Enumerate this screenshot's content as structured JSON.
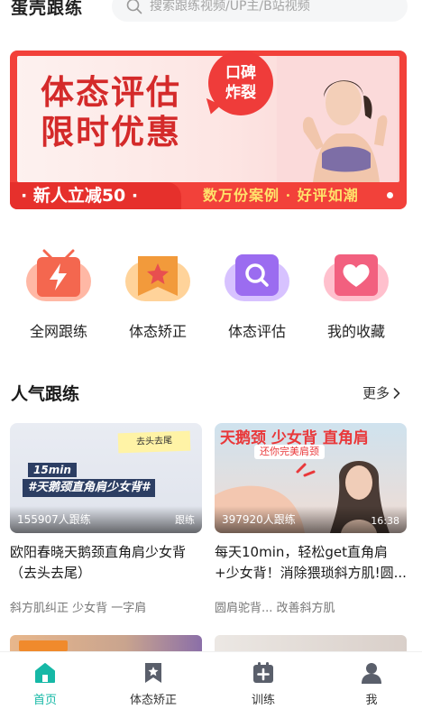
{
  "header": {
    "app_title": "蛋壳跟练",
    "search_placeholder": "搜索跟练视频/UP主/B站视频"
  },
  "banner": {
    "title_line1": "体态评估",
    "title_line2": "限时优惠",
    "bubble_line1": "口碑",
    "bubble_line2": "炸裂",
    "promo": "· 新人立减50 ·",
    "slogan": "数万份案例 · 好评如潮"
  },
  "quick_entries": [
    {
      "label": "全网跟练",
      "icon": "lightning-icon",
      "color": "#f4674f"
    },
    {
      "label": "体态矫正",
      "icon": "star-bookmark-icon",
      "color": "#f29a3b"
    },
    {
      "label": "体态评估",
      "icon": "magnifier-icon",
      "color": "#9b6cf0"
    },
    {
      "label": "我的收藏",
      "icon": "heart-icon",
      "color": "#f2607f"
    }
  ],
  "section": {
    "title": "人气跟练",
    "more": "更多"
  },
  "cards": [
    {
      "thumb_sticky": "去头去尾",
      "thumb_tag_time": "15min",
      "thumb_tag_text": "#天鹅颈直角肩少女背#",
      "views": "155907人跟练",
      "thumb_right": "跟练",
      "title": "欧阳春晓天鹅颈直角肩少女背（去头去尾）",
      "tags": "斜方肌纠正 少女背 一字肩"
    },
    {
      "thumb_heading": "天鹅颈 少女背 直角肩",
      "thumb_subheading": "还你完美肩颈",
      "views": "397920人跟练",
      "thumb_right": "16:38",
      "title": "每天10min，轻松get直角肩+少女背！消除猥琐斜方肌!圆...",
      "tags": "圆肩驼背... 改善斜方肌"
    }
  ],
  "tabbar": [
    {
      "label": "首页",
      "active": true
    },
    {
      "label": "体态矫正",
      "active": false
    },
    {
      "label": "训练",
      "active": false
    },
    {
      "label": "我",
      "active": false
    }
  ],
  "colors": {
    "accent": "#16b8a6",
    "banner_red": "#e6302c",
    "banner_yellow": "#ffe26b"
  }
}
